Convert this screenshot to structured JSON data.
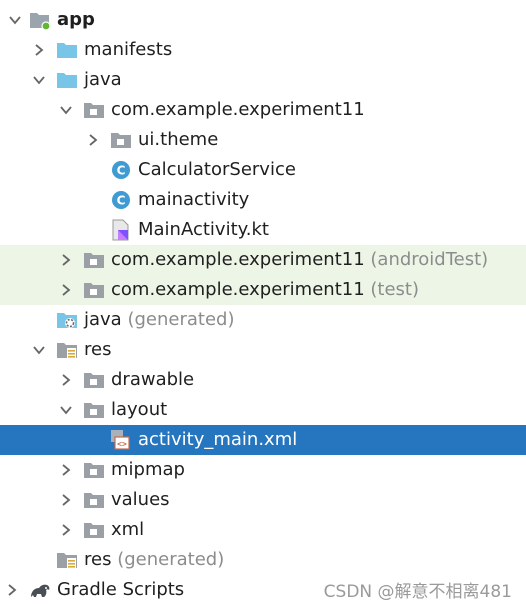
{
  "project_tree": {
    "items": [
      {
        "label": "app",
        "secondary": "",
        "icon": "module-folder-icon",
        "arrow": "expanded"
      },
      {
        "label": "manifests",
        "secondary": "",
        "icon": "folder-icon",
        "arrow": "collapsed"
      },
      {
        "label": "java",
        "secondary": "",
        "icon": "folder-icon",
        "arrow": "expanded"
      },
      {
        "label": "com.example.experiment11",
        "secondary": "",
        "icon": "package-icon",
        "arrow": "expanded"
      },
      {
        "label": "ui.theme",
        "secondary": "",
        "icon": "package-icon",
        "arrow": "collapsed"
      },
      {
        "label": "CalculatorService",
        "secondary": "",
        "icon": "kotlin-class-icon",
        "arrow": "none"
      },
      {
        "label": "mainactivity",
        "secondary": "",
        "icon": "kotlin-class-icon",
        "arrow": "none"
      },
      {
        "label": "MainActivity.kt",
        "secondary": "",
        "icon": "kotlin-file-icon",
        "arrow": "none"
      },
      {
        "label": "com.example.experiment11",
        "secondary": "(androidTest)",
        "icon": "package-icon",
        "arrow": "collapsed"
      },
      {
        "label": "com.example.experiment11",
        "secondary": "(test)",
        "icon": "package-icon",
        "arrow": "collapsed"
      },
      {
        "label": "java",
        "secondary": "(generated)",
        "icon": "generated-folder-icon",
        "arrow": "none"
      },
      {
        "label": "res",
        "secondary": "",
        "icon": "resource-folder-icon",
        "arrow": "expanded"
      },
      {
        "label": "drawable",
        "secondary": "",
        "icon": "package-icon",
        "arrow": "collapsed"
      },
      {
        "label": "layout",
        "secondary": "",
        "icon": "package-icon",
        "arrow": "expanded"
      },
      {
        "label": "activity_main.xml",
        "secondary": "",
        "icon": "layout-xml-icon",
        "arrow": "none"
      },
      {
        "label": "mipmap",
        "secondary": "",
        "icon": "package-icon",
        "arrow": "collapsed"
      },
      {
        "label": "values",
        "secondary": "",
        "icon": "package-icon",
        "arrow": "collapsed"
      },
      {
        "label": "xml",
        "secondary": "",
        "icon": "package-icon",
        "arrow": "collapsed"
      },
      {
        "label": "res",
        "secondary": "(generated)",
        "icon": "resource-folder-icon",
        "arrow": "none"
      },
      {
        "label": "Gradle Scripts",
        "secondary": "",
        "icon": "gradle-icon",
        "arrow": "collapsed"
      }
    ]
  },
  "watermark": "CSDN @解意不相离481",
  "colors": {
    "selection": "#2675bf",
    "test_source_highlight": "#edf6e6",
    "folder_blue": "#79c5e8",
    "package_gray": "#8c8c8c",
    "kotlin_class": "#3f9bd1",
    "secondary_text": "#8c8c8c"
  }
}
